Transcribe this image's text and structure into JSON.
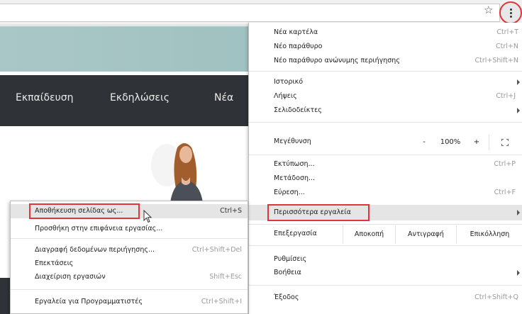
{
  "browser": {
    "star_icon": "star-icon",
    "menu_icon": "kebab-menu-icon",
    "accent": "#e0353a"
  },
  "page": {
    "nav_items": [
      "Εκπαίδευση",
      "Εκδηλώσεις",
      "Νέα"
    ]
  },
  "menu": {
    "new_tab": {
      "label": "Νέα καρτέλα",
      "shortcut": "Ctrl+T"
    },
    "new_window": {
      "label": "Νέο παράθυρο",
      "shortcut": "Ctrl+N"
    },
    "new_incognito": {
      "label": "Νέο παράθυρο ανώνυμης περιήγησης",
      "shortcut": "Ctrl+Shift+N"
    },
    "history": {
      "label": "Ιστορικό"
    },
    "downloads": {
      "label": "Λήψεις",
      "shortcut": "Ctrl+J"
    },
    "bookmarks": {
      "label": "Σελιδοδείκτες"
    },
    "zoom": {
      "label": "Μεγέθυνση",
      "minus": "-",
      "value": "100%",
      "plus": "+"
    },
    "print": {
      "label": "Εκτύπωση...",
      "shortcut": "Ctrl+P"
    },
    "cast": {
      "label": "Μετάδοση..."
    },
    "find": {
      "label": "Εύρεση...",
      "shortcut": "Ctrl+F"
    },
    "more_tools": {
      "label": "Περισσότερα εργαλεία"
    },
    "edit": {
      "label": "Επεξεργασία",
      "cut": "Αποκοπή",
      "copy": "Αντιγραφή",
      "paste": "Επικόλληση"
    },
    "settings": {
      "label": "Ρυθμίσεις"
    },
    "help": {
      "label": "Βοήθεια"
    },
    "exit": {
      "label": "Έξοδος",
      "shortcut": "Ctrl+Shift+Q"
    }
  },
  "submenu": {
    "save_page": {
      "label": "Αποθήκευση σελίδας ως...",
      "shortcut": "Ctrl+S"
    },
    "add_to_desktop": {
      "label": "Προσθήκη στην επιφάνεια εργασίας..."
    },
    "clear_data": {
      "label": "Διαγραφή δεδομένων περιήγησης...",
      "shortcut": "Ctrl+Shift+Del"
    },
    "extensions": {
      "label": "Επεκτάσεις"
    },
    "task_manager": {
      "label": "Διαχείριση εργασιών",
      "shortcut": "Shift+Esc"
    },
    "dev_tools": {
      "label": "Εργαλεία για Προγραμματιστές",
      "shortcut": "Ctrl+Shift+I"
    }
  }
}
